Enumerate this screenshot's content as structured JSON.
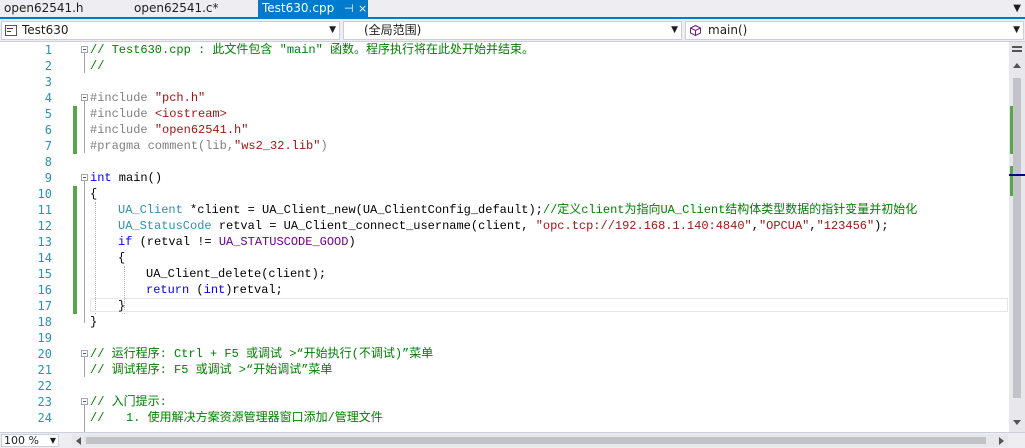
{
  "tabs": [
    {
      "label": "open62541.h",
      "active": false
    },
    {
      "label": "open62541.c*",
      "active": false
    },
    {
      "label": "Test630.cpp",
      "active": true,
      "pin": "⊣",
      "close": "×"
    }
  ],
  "nav": {
    "project": "Test630",
    "scope": "(全局范围)",
    "member": "main()"
  },
  "line_numbers": [
    "1",
    "2",
    "3",
    "4",
    "5",
    "6",
    "7",
    "8",
    "9",
    "10",
    "11",
    "12",
    "13",
    "14",
    "15",
    "16",
    "17",
    "18",
    "19",
    "20",
    "21",
    "22",
    "23",
    "24"
  ],
  "code": {
    "l1": "// Test630.cpp : 此文件包含 \"main\" 函数。程序执行将在此处开始并结束。",
    "l2": "//",
    "l4a": "#include ",
    "l4b": "\"pch.h\"",
    "l5a": "#include ",
    "l5b": "<iostream>",
    "l6a": "#include ",
    "l6b": "\"open62541.h\"",
    "l7a": "#pragma comment(lib,",
    "l7b": "\"ws2_32.lib\"",
    "l7c": ")",
    "l9a": "int",
    "l9b": " main()",
    "l10": "{",
    "l11a": "UA_Client",
    "l11b": " *client = UA_Client_new(UA_ClientConfig_default);",
    "l11c": "//定义client为指向UA_Client结构体类型数据的指针变量并初始化",
    "l12a": "UA_StatusCode",
    "l12b": " retval = UA_Client_connect_username(client, ",
    "l12c": "\"opc.tcp://192.168.1.140:4840\"",
    "l12d": ",",
    "l12e": "\"OPCUA\"",
    "l12f": ",",
    "l12g": "\"123456\"",
    "l12h": ");",
    "l13a": "if",
    "l13b": " (retval != ",
    "l13c": "UA_STATUSCODE_GOOD",
    "l13d": ")",
    "l14": "{",
    "l15": "UA_Client_delete(client);",
    "l16a": "return",
    "l16b": " (",
    "l16c": "int",
    "l16d": ")retval;",
    "l17": "}",
    "l18": "}",
    "l20": "// 运行程序: Ctrl + F5 或调试 >“开始执行(不调试)”菜单",
    "l21": "// 调试程序: F5 或调试 >“开始调试”菜单",
    "l23": "// 入门提示:",
    "l24": "//   1. 使用解决方案资源管理器窗口添加/管理文件"
  },
  "zoom": "100 %",
  "icons": {
    "project": "cpp-project-icon",
    "member": "method-cube-icon"
  },
  "colors": {
    "accent": "#007acc",
    "comment": "#008000",
    "keyword": "#0000ff",
    "string": "#a31515",
    "type": "#2b91af",
    "changed": "#57a64a"
  }
}
